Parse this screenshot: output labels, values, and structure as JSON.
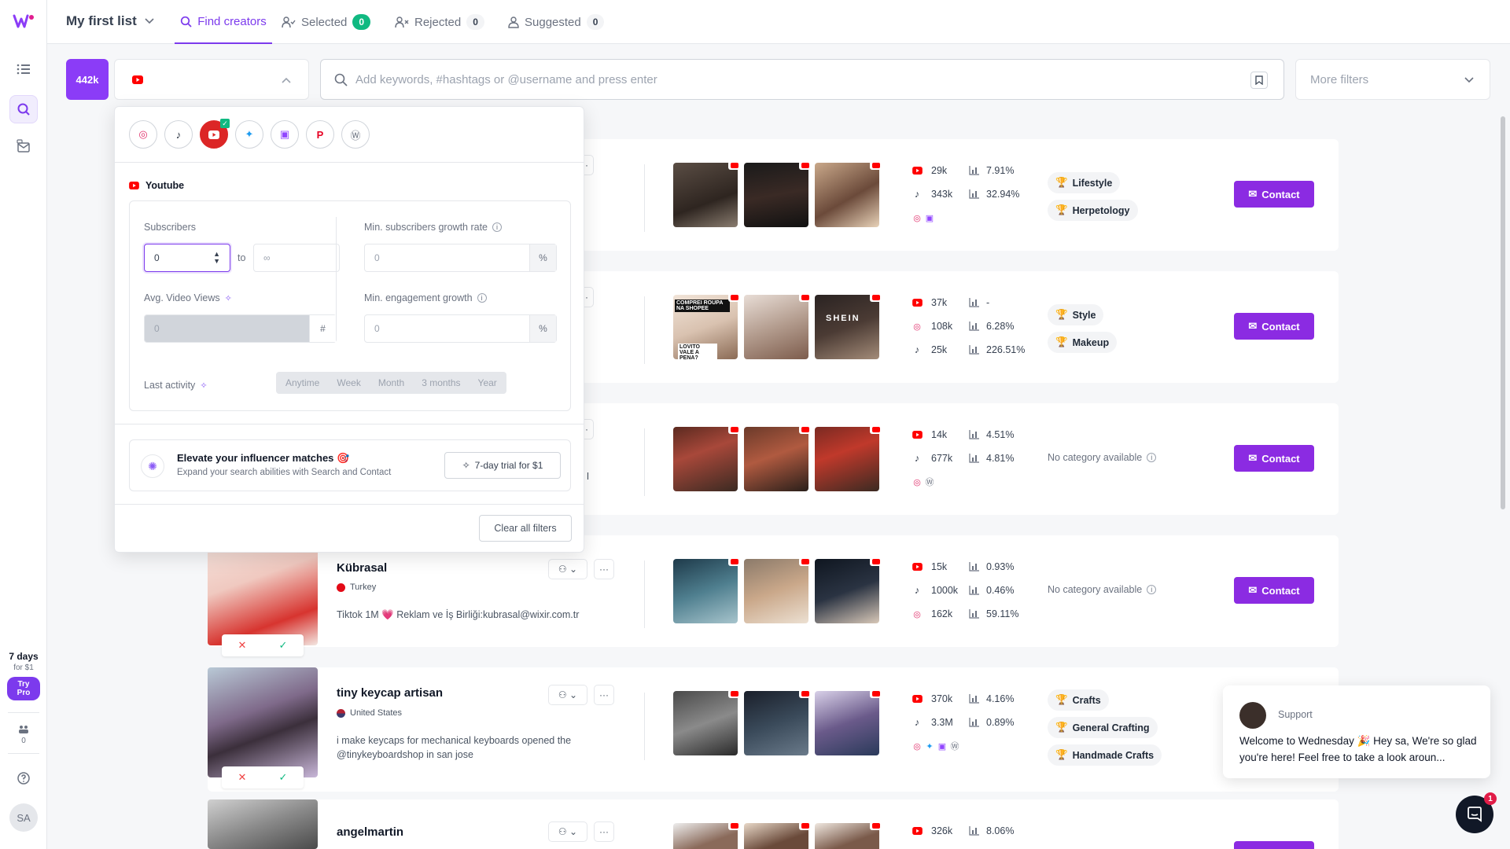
{
  "topbar": {
    "list_title": "My first list",
    "tabs": [
      {
        "label": "Find creators"
      },
      {
        "label": "Selected",
        "count": "0"
      },
      {
        "label": "Rejected",
        "count": "0"
      },
      {
        "label": "Suggested",
        "count": "0"
      }
    ]
  },
  "rail": {
    "trial_days": "7 days",
    "trial_price": "for $1",
    "try_pro": "Try Pro",
    "credits": "0",
    "avatar_initials": "SA"
  },
  "filters": {
    "result_count": "442k",
    "search_placeholder": "Add keywords, #hashtags or @username and press enter",
    "more_filters": "More filters"
  },
  "popover": {
    "platform_label": "Youtube",
    "subscribers_label": "Subscribers",
    "subscribers_min": "0",
    "to_label": "to",
    "subscribers_max_placeholder": "∞",
    "growth_rate_label": "Min. subscribers growth rate",
    "growth_rate_placeholder": "0",
    "avg_views_label": "Avg. Video Views",
    "avg_views_placeholder": "0",
    "engagement_growth_label": "Min. engagement growth",
    "engagement_growth_placeholder": "0",
    "last_activity_label": "Last activity",
    "activity_options": [
      "Anytime",
      "Week",
      "Month",
      "3 months",
      "Year"
    ],
    "promo_title": "Elevate your influencer matches 🎯",
    "promo_sub": "Expand your search abilities with Search and Contact",
    "trial_button": "7-day trial for $1",
    "clear_button": "Clear all filters",
    "percent": "%",
    "hash": "#"
  },
  "cards": [
    {
      "name": "",
      "stats": [
        {
          "platform": "youtube",
          "followers": "29k",
          "er": "7.91%"
        },
        {
          "platform": "tiktok",
          "followers": "343k",
          "er": "32.94%"
        }
      ],
      "extra_platforms": [
        "instagram",
        "twitch"
      ],
      "categories": [
        "Lifestyle",
        "Herpetology"
      ],
      "contact": "Contact"
    },
    {
      "name": "",
      "stats": [
        {
          "platform": "youtube",
          "followers": "37k",
          "er": "-"
        },
        {
          "platform": "instagram",
          "followers": "108k",
          "er": "6.28%"
        },
        {
          "platform": "tiktok",
          "followers": "25k",
          "er": "226.51%"
        }
      ],
      "categories": [
        "Style",
        "Makeup"
      ],
      "thumb_texts": [
        "COMPREI ROUPA NA SHOPEE",
        "LOVITO VALE A PENA?",
        "SHEIN"
      ],
      "contact": "Contact"
    },
    {
      "name": "",
      "bio_fragment": "it I",
      "stats": [
        {
          "platform": "youtube",
          "followers": "14k",
          "er": "4.51%"
        },
        {
          "platform": "tiktok",
          "followers": "677k",
          "er": "4.81%"
        }
      ],
      "extra_platforms": [
        "instagram",
        "wordpress"
      ],
      "no_category": "No category available",
      "contact": "Contact"
    },
    {
      "name": "Kübrasal",
      "country": "Turkey",
      "bio": "Tiktok 1M 💗 Reklam ve İş Birliği:kubrasal@wixir.com.tr",
      "stats": [
        {
          "platform": "youtube",
          "followers": "15k",
          "er": "0.93%"
        },
        {
          "platform": "tiktok",
          "followers": "1000k",
          "er": "0.46%"
        },
        {
          "platform": "instagram",
          "followers": "162k",
          "er": "59.11%"
        }
      ],
      "no_category": "No category available",
      "contact": "Contact"
    },
    {
      "name": "tiny keycap artisan",
      "country": "United States",
      "bio": "i make keycaps for mechanical keyboards opened the @tinykeyboardshop in san jose",
      "stats": [
        {
          "platform": "youtube",
          "followers": "370k",
          "er": "4.16%"
        },
        {
          "platform": "tiktok",
          "followers": "3.3M",
          "er": "0.89%"
        }
      ],
      "extra_platforms": [
        "instagram",
        "twitter",
        "twitch",
        "wordpress"
      ],
      "categories": [
        "Crafts",
        "General Crafting",
        "Handmade Crafts"
      ],
      "contact": "Contact"
    },
    {
      "name": "angelmartin",
      "stats": [
        {
          "platform": "youtube",
          "followers": "326k",
          "er": "8.06%"
        }
      ]
    }
  ],
  "support": {
    "who": "Support",
    "message": "Welcome to Wednesday 🎉 Hey sa, We're so glad you're here! Feel free to take a look aroun...",
    "badge": "1"
  },
  "colors": {
    "accent": "#7c3aed",
    "contact": "#8b2be2",
    "youtube": "#ff0000",
    "selected_badge": "#10b981"
  }
}
